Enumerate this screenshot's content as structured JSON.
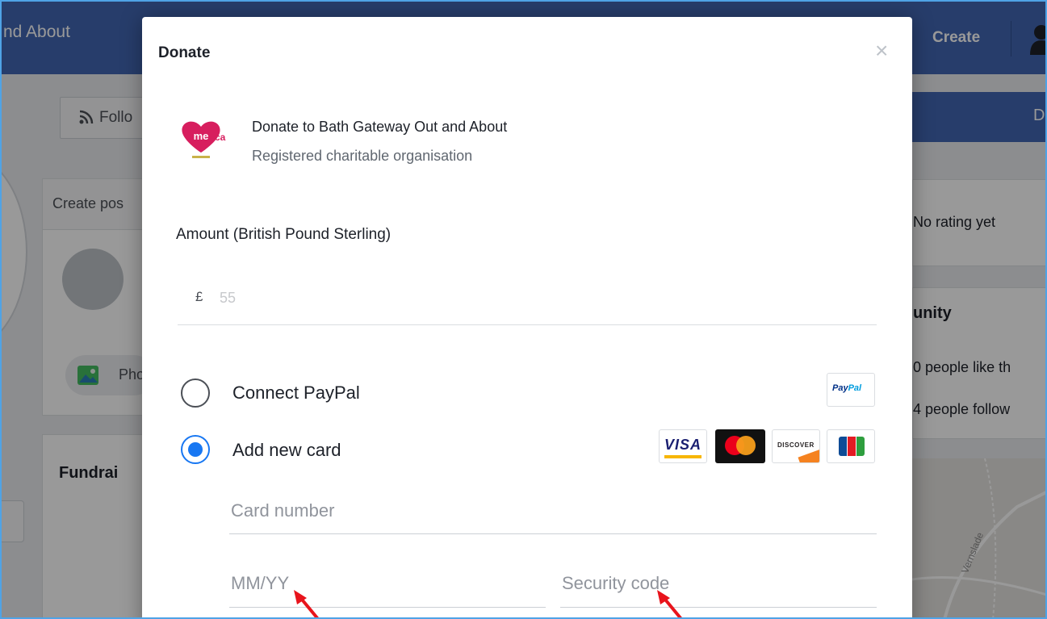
{
  "background_page": {
    "header_left_text": "nd About",
    "header_create": "Create",
    "follow_button": "Follo",
    "create_post_header": "Create pos",
    "photo_button": "Pho",
    "fundraiser_header": "Fundrai",
    "right_button": "D",
    "rating_text": "No rating yet",
    "community_title": "unity",
    "likes_text": "0 people like th",
    "follows_text": "4 people follow",
    "map_label": "Vernslade"
  },
  "modal": {
    "title": "Donate",
    "close_glyph": "×",
    "org_name": "Donate to Bath Gateway Out and About",
    "org_subtitle": "Registered charitable organisation",
    "amount_label": "Amount (British Pound Sterling)",
    "currency_symbol": "£",
    "amount_placeholder": "55",
    "payment_options": [
      {
        "label": "Connect PayPal",
        "selected": false
      },
      {
        "label": "Add new card",
        "selected": true
      }
    ],
    "paypal_badge": {
      "pay": "Pay",
      "pal": "Pal"
    },
    "card_brands": {
      "visa": "VISA",
      "discover": "DISCOVER"
    },
    "card_number_placeholder": "Card number",
    "expiry_placeholder": "MM/YY",
    "security_code_placeholder": "Security code"
  },
  "colors": {
    "facebook_blue": "#4267b2",
    "selected_radio": "#1877f2",
    "annotation_arrow": "#e8141c",
    "screenshot_border": "#4fa3e6"
  }
}
